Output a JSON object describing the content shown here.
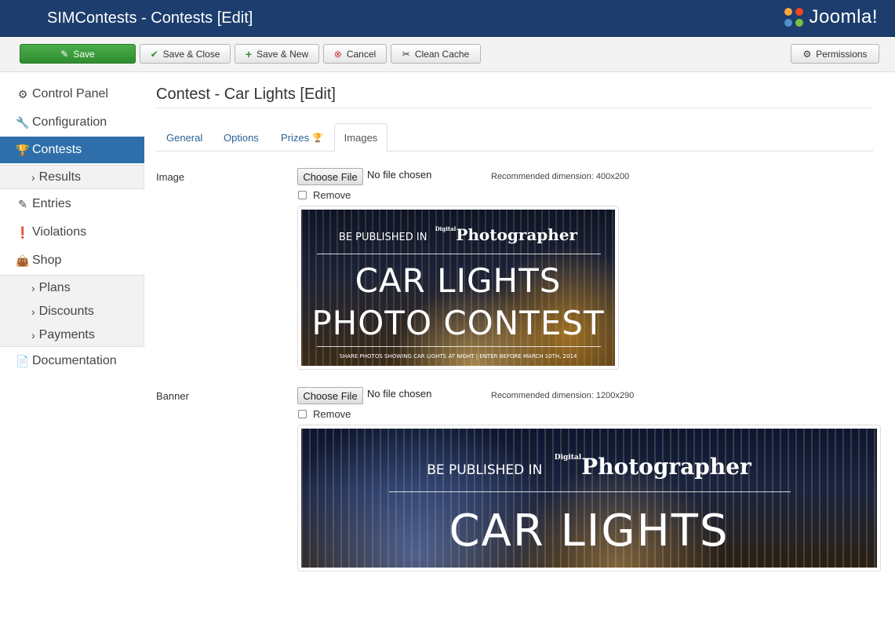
{
  "header": {
    "title": "SIMContests - Contests [Edit]",
    "logo_text": "Joomla!"
  },
  "toolbar": {
    "save": "Save",
    "save_close": "Save & Close",
    "save_new": "Save & New",
    "cancel": "Cancel",
    "clean_cache": "Clean Cache",
    "permissions": "Permissions"
  },
  "sidebar": {
    "items": [
      {
        "label": "Control Panel",
        "icon": "gears-icon"
      },
      {
        "label": "Configuration",
        "icon": "wrench-icon"
      },
      {
        "label": "Contests",
        "icon": "trophy-icon",
        "active": true
      },
      {
        "label": "Entries",
        "icon": "edit-icon"
      },
      {
        "label": "Violations",
        "icon": "exclamation-icon"
      },
      {
        "label": "Shop",
        "icon": "shopping-bag-icon"
      },
      {
        "label": "Documentation",
        "icon": "document-icon"
      }
    ],
    "contests_sub": [
      {
        "label": "Results"
      }
    ],
    "shop_sub": [
      {
        "label": "Plans"
      },
      {
        "label": "Discounts"
      },
      {
        "label": "Payments"
      }
    ]
  },
  "main": {
    "page_title": "Contest - Car Lights [Edit]",
    "tabs": [
      {
        "label": "General"
      },
      {
        "label": "Options"
      },
      {
        "label": "Prizes"
      },
      {
        "label": "Images",
        "active": true
      }
    ],
    "image_field": {
      "label": "Image",
      "choose_file": "Choose File",
      "file_status": "No file chosen",
      "recommended": "Recommended dimension: 400x200",
      "remove_label": "Remove",
      "preview": {
        "line1": "BE PUBLISHED IN",
        "brand_small": "Digital",
        "brand": "Photographer",
        "title1": "CAR LIGHTS",
        "title2": "PHOTO CONTEST",
        "footer": "SHARE PHOTOS SHOWING CAR LIGHTS AT NIGHT  |  ENTER BEFORE MARCH 10TH, 2014"
      }
    },
    "banner_field": {
      "label": "Banner",
      "choose_file": "Choose File",
      "file_status": "No file chosen",
      "recommended": "Recommended dimension: 1200x290",
      "remove_label": "Remove",
      "preview": {
        "line1": "BE PUBLISHED IN",
        "brand_small": "Digital",
        "brand": "Photographer",
        "title1": "CAR LIGHTS"
      }
    }
  },
  "colors": {
    "header_bg": "#1c3d6e",
    "active_nav": "#2e6fab",
    "save_green": "#3a9d3a",
    "link": "#2a6496"
  }
}
